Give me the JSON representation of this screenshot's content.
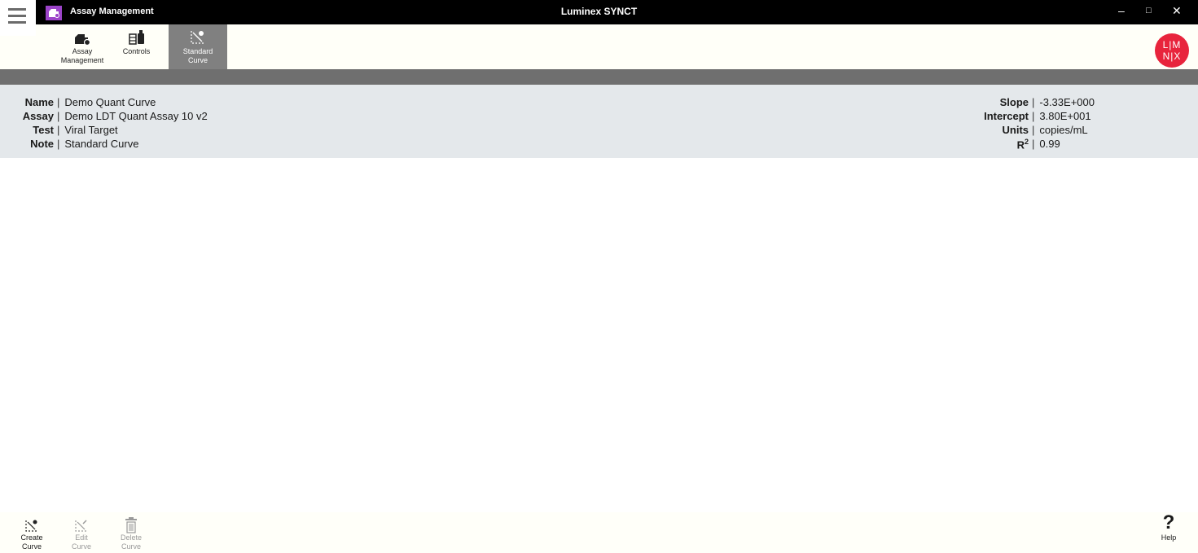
{
  "titlebar": {
    "app_title": "Assay Management",
    "window_title": "Luminex SYNCT",
    "minimize_glyph": "–",
    "maximize_glyph": "□",
    "close_glyph": "✕"
  },
  "ribbon": {
    "items": [
      {
        "label_line1": "Assay",
        "label_line2": "Management",
        "icon": "assay-icon"
      },
      {
        "label_line1": "Controls",
        "label_line2": "",
        "icon": "controls-icon"
      },
      {
        "label_line1": "Standard",
        "label_line2": "Curve",
        "icon": "standard-curve-icon",
        "active": true
      }
    ]
  },
  "logo": {
    "top": "L|M",
    "bottom": "N|X"
  },
  "curve": {
    "name_label": "Name",
    "name": "Demo Quant Curve",
    "assay_label": "Assay",
    "assay": "Demo LDT Quant Assay 10 v2",
    "test_label": "Test",
    "test": "Viral Target",
    "note_label": "Note",
    "note": "Standard Curve",
    "slope_label": "Slope",
    "slope": "-3.33E+000",
    "intercept_label": "Intercept",
    "intercept": "3.80E+001",
    "units_label": "Units",
    "units": "copies/mL",
    "r2_label": "R",
    "r2_sup": "2",
    "r2": "0.99",
    "separator": "|"
  },
  "bottom": {
    "create": {
      "line1": "Create",
      "line2": "Curve"
    },
    "edit": {
      "line1": "Edit",
      "line2": "Curve"
    },
    "delete": {
      "line1": "Delete",
      "line2": "Curve"
    },
    "help": {
      "glyph": "?",
      "label": "Help"
    }
  },
  "colors": {
    "accent": "#9c44c9",
    "logo": "#e8243c",
    "active_tab": "#808080",
    "info_bg": "#e4e8eb"
  }
}
